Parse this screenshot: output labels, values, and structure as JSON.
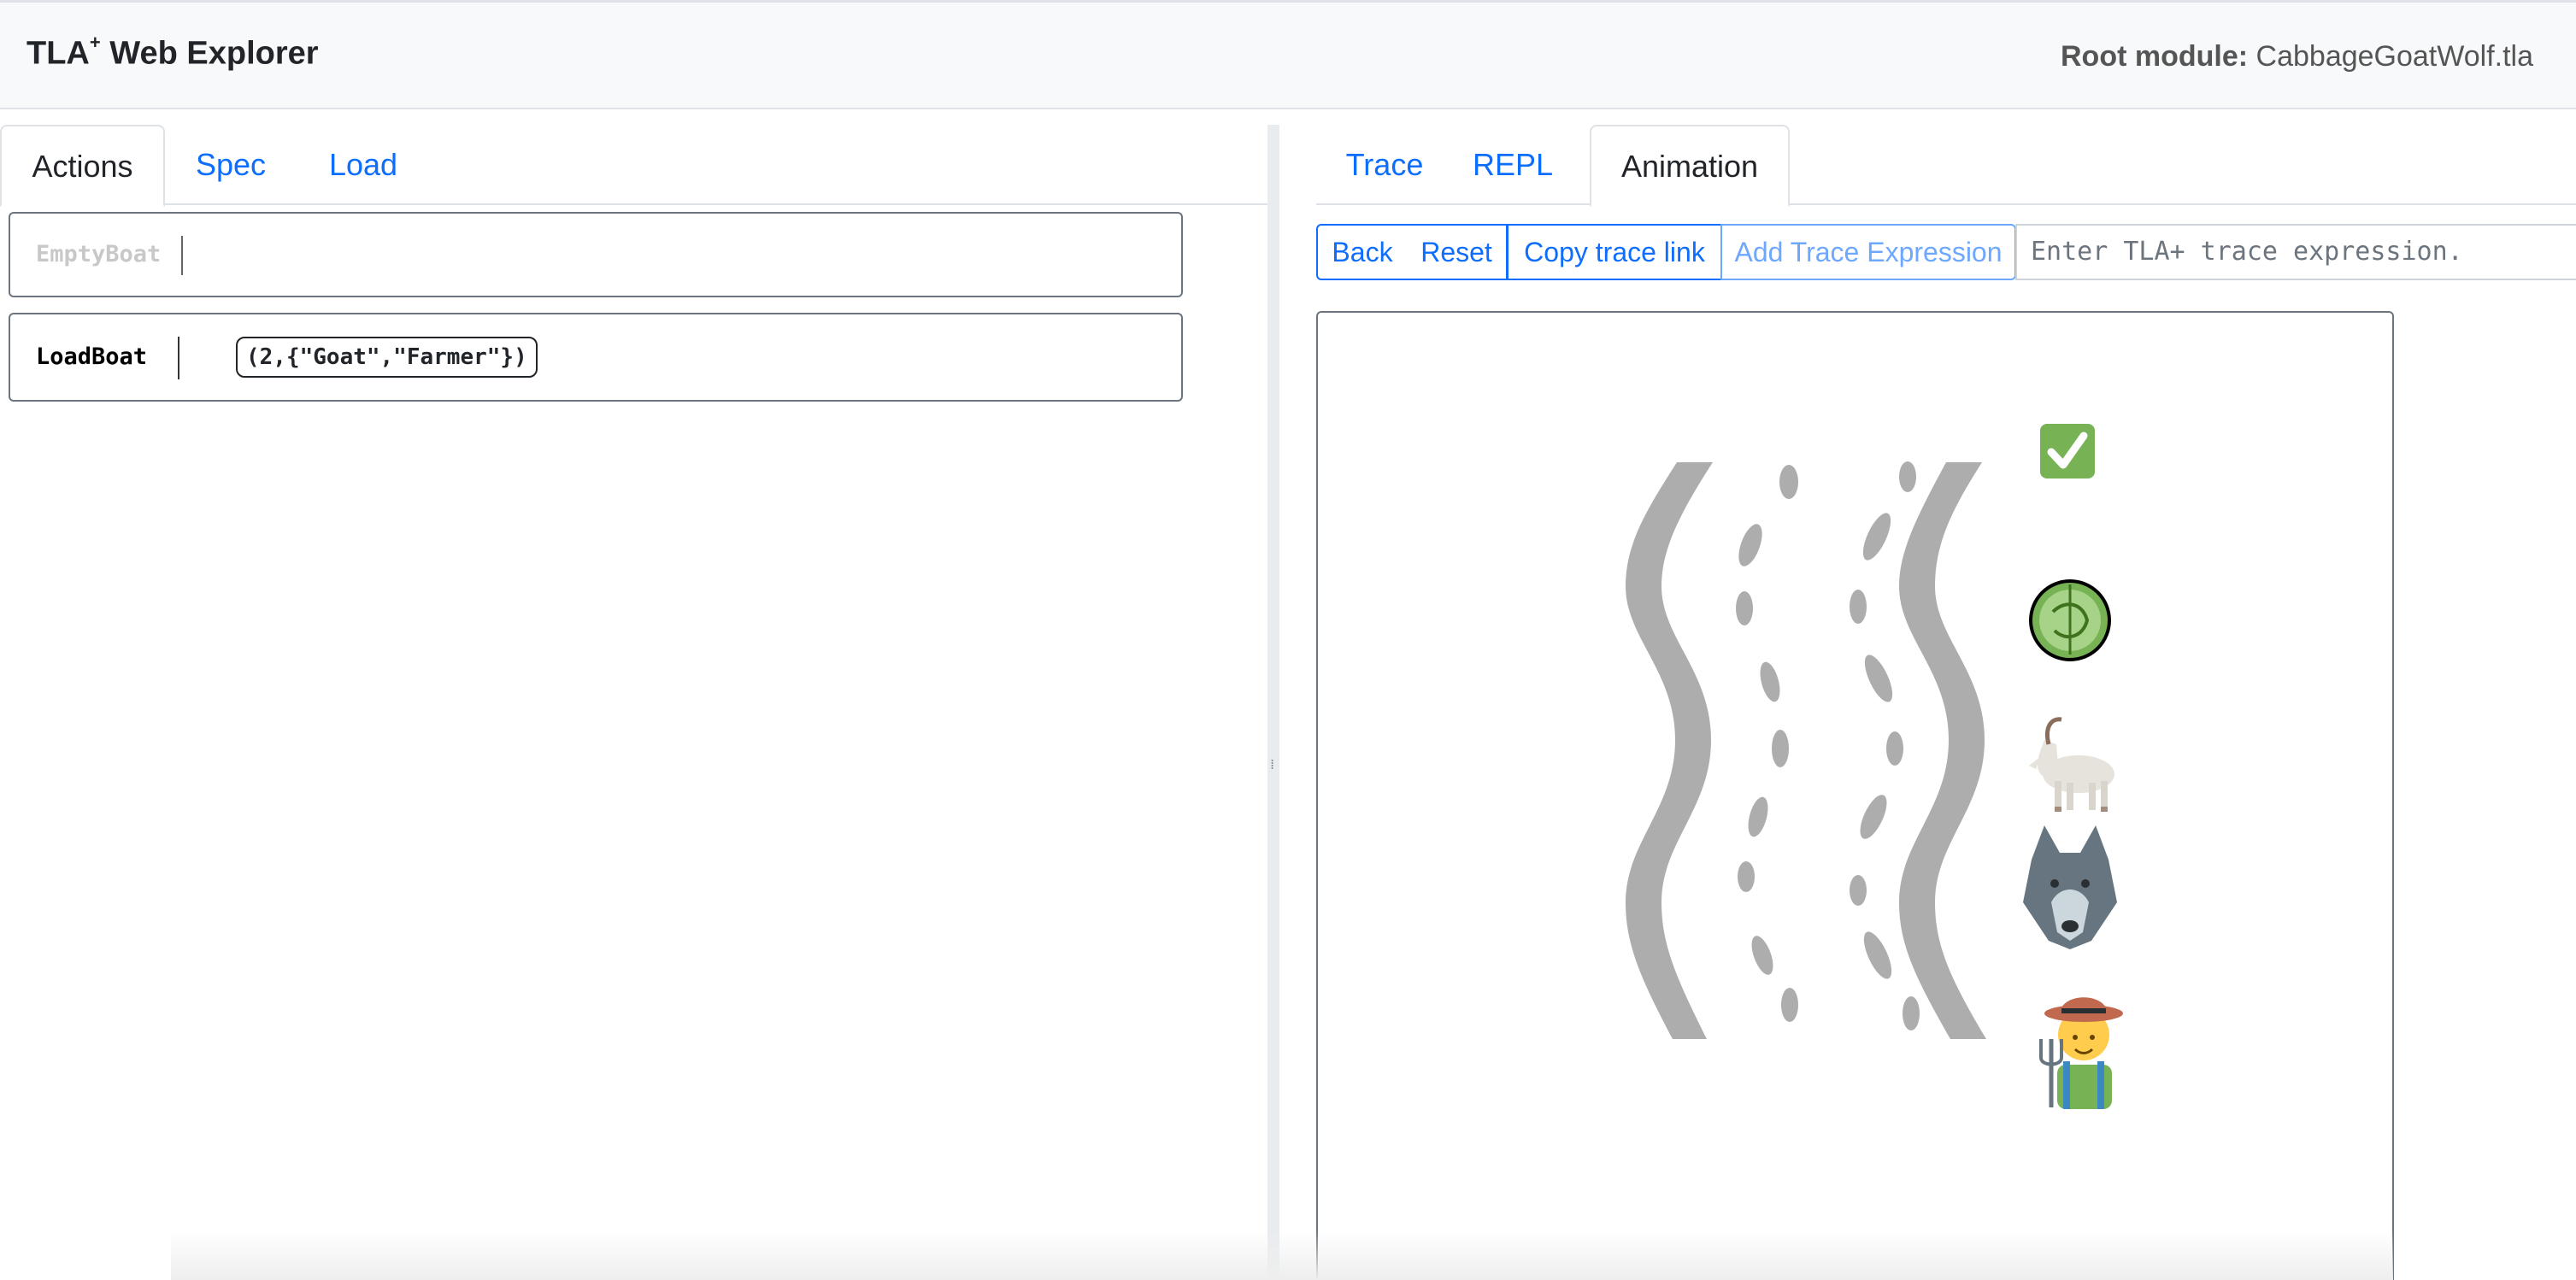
{
  "header": {
    "brand": "TLA",
    "brand_sup": "+",
    "brand_rest": " Web Explorer",
    "root_label": "Root module:",
    "root_file": "CabbageGoatWolf.tla"
  },
  "left_tabs": [
    {
      "label": "Actions",
      "active": true
    },
    {
      "label": "Spec",
      "active": false
    },
    {
      "label": "Load",
      "active": false
    }
  ],
  "actions": [
    {
      "name": "EmptyBoat",
      "enabled": false,
      "param": ""
    },
    {
      "name": "LoadBoat",
      "enabled": true,
      "param": "(2,{\"Goat\",\"Farmer\"})"
    }
  ],
  "right_tabs": [
    {
      "label": "Trace",
      "active": false
    },
    {
      "label": "REPL",
      "active": false
    },
    {
      "label": "Animation",
      "active": true
    }
  ],
  "toolbar": {
    "back": "Back",
    "reset": "Reset",
    "copy": "Copy trace link",
    "add_expr": "Add Trace Expression",
    "expr_placeholder": "Enter TLA+ trace expression."
  },
  "animation": {
    "status_icon": "check-mark-icon",
    "items": [
      "cabbage-icon",
      "goat-icon",
      "wolf-icon",
      "farmer-icon"
    ],
    "colors": {
      "river": "#adadad",
      "check": "#77b255"
    }
  }
}
